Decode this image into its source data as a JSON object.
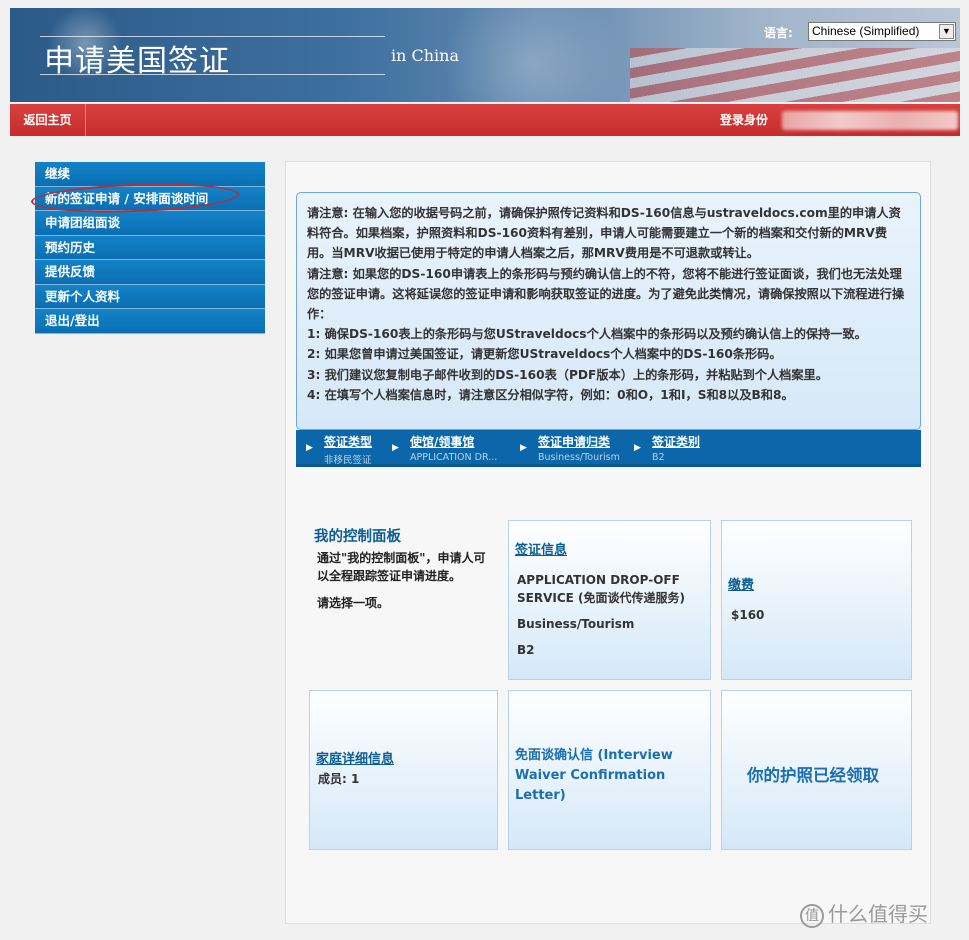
{
  "header": {
    "title": "申请美国签证",
    "subtitle": "in China",
    "language_label": "语言:",
    "language_value": "Chinese (Simplified)"
  },
  "navbar": {
    "home_label": "返回主页",
    "login_label": "登录身份"
  },
  "menu": {
    "items": [
      {
        "label": "继续"
      },
      {
        "label": "新的签证申请 / 安排面谈时间"
      },
      {
        "label": "申请团组面谈"
      },
      {
        "label": "预约历史"
      },
      {
        "label": "提供反馈"
      },
      {
        "label": "更新个人资料"
      },
      {
        "label": "退出/登出"
      }
    ]
  },
  "notice": {
    "lines": [
      "请注意: 在输入您的收据号码之前，请确保护照传记资料和DS-160信息与ustraveldocs.com里的申请人资料符合。如果档案，护照资料和DS-160资料有差别，申请人可能需要建立一个新的档案和交付新的MRV费用。当MRV收据已使用于特定的申请人档案之后，那MRV费用是不可退款或转让。",
      "请注意: 如果您的DS-160申请表上的条形码与预约确认信上的不符，您将不能进行签证面谈，我们也无法处理您的签证申请。这将延误您的签证申请和影响获取签证的进度。为了避免此类情况，请确保按照以下流程进行操作：",
      "1: 确保DS-160表上的条形码与您UStraveldocs个人档案中的条形码以及预约确认信上的保持一致。",
      "2: 如果您曾申请过美国签证，请更新您UStraveldocs个人档案中的DS-160条形码。",
      "3: 我们建议您复制电子邮件收到的DS-160表（PDF版本）上的条形码，并粘贴到个人档案里。",
      "4: 在填写个人档案信息时，请注意区分相似字符，例如：0和O，1和I，S和8以及B和8。"
    ]
  },
  "breadcrumbs": [
    {
      "title": "签证类型",
      "value": "非移民签证"
    },
    {
      "title": "使馆/领事馆",
      "value": "APPLICATION DR..."
    },
    {
      "title": "签证申请归类",
      "value": "Business/Tourism"
    },
    {
      "title": "签证类别",
      "value": "B2"
    }
  ],
  "dashboard": {
    "title": "我的控制面板",
    "description": "通过\"我的控制面板\"，申请人可以全程跟踪签证申请进度。",
    "choose": "请选择一项。",
    "visa_info": {
      "link": "签证信息",
      "service": "APPLICATION DROP-OFF SERVICE (免面谈代传递服务)",
      "category": "Business/Tourism",
      "class": "B2"
    },
    "payment": {
      "link": "缴费",
      "amount": "$160"
    },
    "family": {
      "link": "家庭详细信息",
      "members": "成员:  1"
    },
    "waiver": {
      "text": "免面谈确认信        (Interview Waiver Confirmation Letter)"
    },
    "passport": {
      "text": "你的护照已经领取"
    }
  },
  "watermark": {
    "badge": "值",
    "text": "什么值得买"
  }
}
